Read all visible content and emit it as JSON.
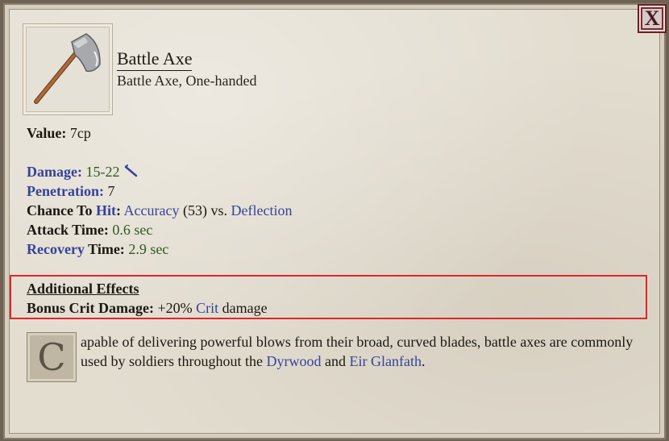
{
  "window": {
    "close_label": "X"
  },
  "item": {
    "name": "Battle Axe",
    "type_line": "Battle Axe, One-handed"
  },
  "stats": {
    "value_label": "Value:",
    "value": "7cp",
    "damage_label": "Damage:",
    "damage_value": "15-22",
    "damage_type_icon": "slash-icon",
    "penetration_label": "Penetration:",
    "penetration_value": "7",
    "chance_label_pre": "Chance To ",
    "chance_label_hit": "Hit",
    "chance_label_post": ":",
    "accuracy_word": "Accuracy",
    "accuracy_value": "(53)",
    "vs_text": "vs.",
    "deflection_word": "Deflection",
    "attack_time_label": "Attack Time:",
    "attack_time_value": "0.6 sec",
    "recovery_label_blue": "Recovery",
    "recovery_label_rest": " Time:",
    "recovery_value": "2.9 sec"
  },
  "effects": {
    "title": "Additional Effects",
    "bonus_label": "Bonus Crit Damage:",
    "bonus_value": "+20%",
    "crit_word": "Crit",
    "damage_word": "damage"
  },
  "description": {
    "drop_cap": "C",
    "text_1": "apable of delivering powerful blows from their broad, curved blades, battle axes are commonly used by soldiers throughout the ",
    "link_1": "Dyrwood",
    "text_2": " and ",
    "link_2": "Eir Glanfath",
    "text_3": "."
  },
  "colors": {
    "link_blue": "#35439a",
    "value_green": "#2c5a20",
    "highlight_red": "#e0262b"
  }
}
